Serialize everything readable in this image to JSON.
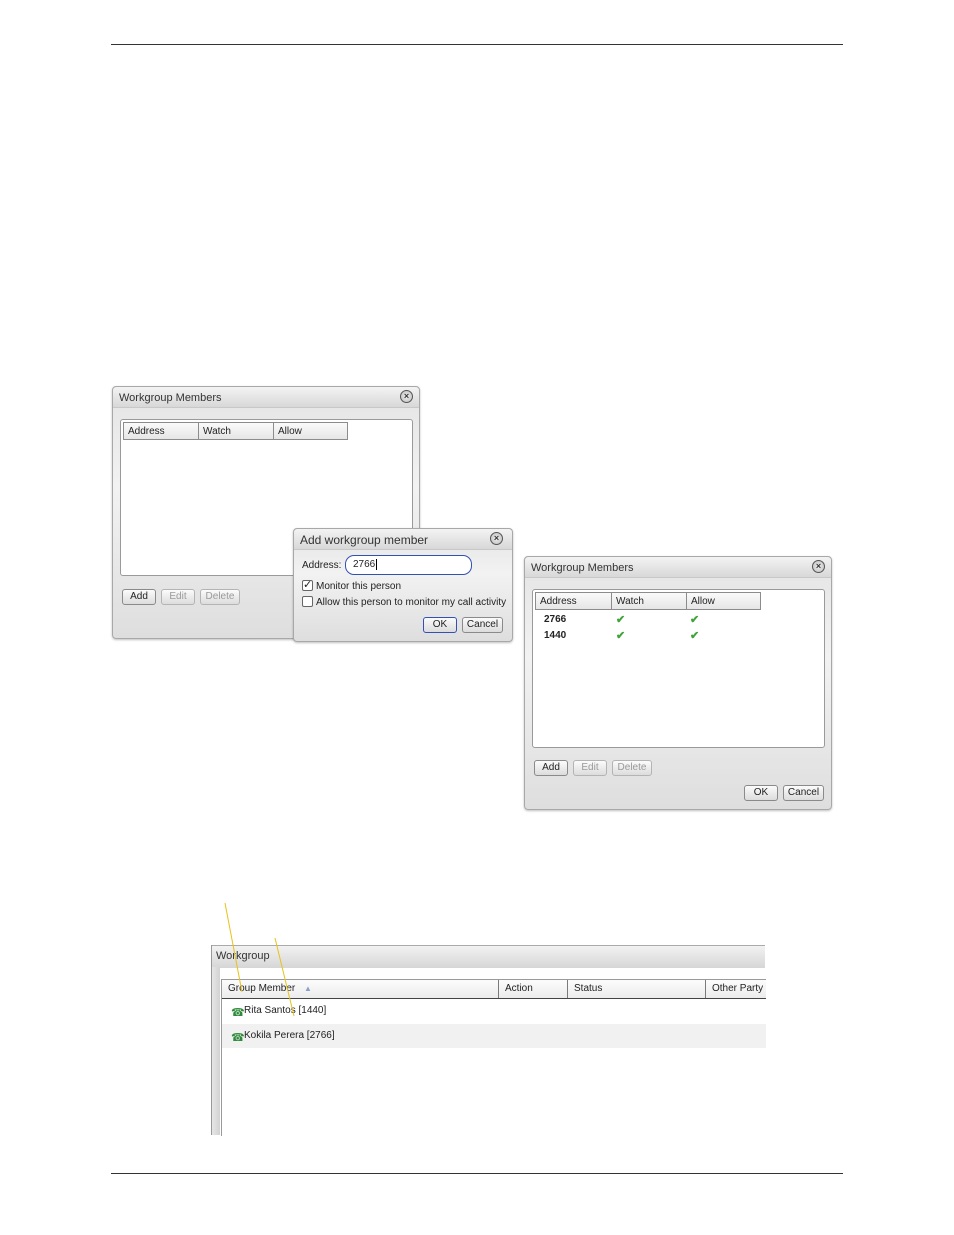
{
  "dialog_empty": {
    "title": "Workgroup Members",
    "columns": [
      "Address",
      "Watch",
      "Allow"
    ],
    "buttons": {
      "add": "Add",
      "edit": "Edit",
      "delete": "Delete"
    }
  },
  "dialog_add": {
    "title": "Add workgroup member",
    "address_label": "Address:",
    "address_value": "2766",
    "monitor_label": "Monitor this person",
    "monitor_checked": true,
    "allow_label": "Allow this person to monitor my call activity",
    "allow_checked": false,
    "ok": "OK",
    "cancel": "Cancel"
  },
  "dialog_filled": {
    "title": "Workgroup Members",
    "columns": [
      "Address",
      "Watch",
      "Allow"
    ],
    "rows": [
      {
        "address": "2766",
        "watch": true,
        "allow": true
      },
      {
        "address": "1440",
        "watch": true,
        "allow": true
      }
    ],
    "buttons": {
      "add": "Add",
      "edit": "Edit",
      "delete": "Delete",
      "ok": "OK",
      "cancel": "Cancel"
    }
  },
  "workgroup_panel": {
    "title": "Workgroup",
    "columns": [
      "Group Member",
      "Action",
      "Status",
      "Other Party"
    ],
    "sort_indicator": "▲",
    "members": [
      "Rita Santos [1440]",
      "Kokila Perera [2766]"
    ]
  },
  "icons": {
    "close": "close-icon",
    "check": "check-icon",
    "phone": "phone-icon"
  },
  "colors": {
    "accent_border": "#3350b5",
    "check_green": "#3fa33a",
    "callout_line": "#e8c21a"
  }
}
